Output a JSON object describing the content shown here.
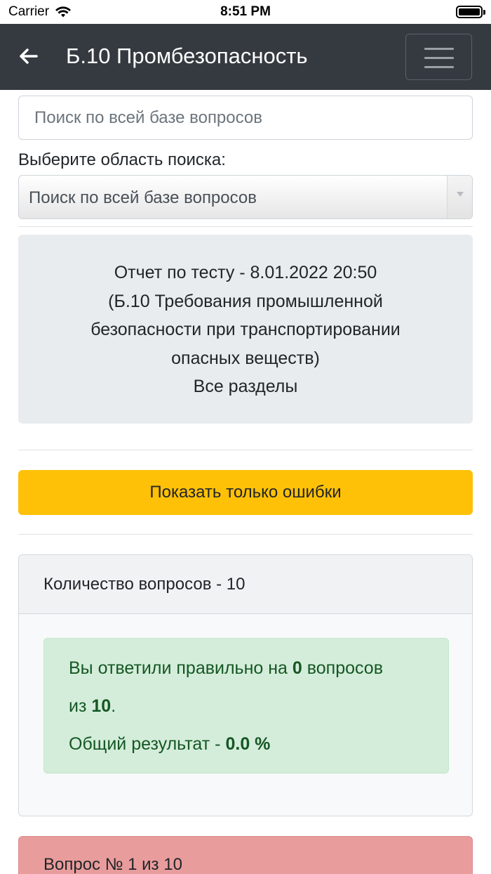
{
  "status_bar": {
    "carrier": "Carrier",
    "time": "8:51 PM"
  },
  "navbar": {
    "title": "Б.10 Промбезопасность"
  },
  "search": {
    "placeholder": "Поиск по всей базе вопросов"
  },
  "scope": {
    "label": "Выберите область поиска:",
    "selected": "Поиск по всей базе вопросов"
  },
  "report": {
    "lines": [
      "Отчет по тесту - 8.01.2022 20:50",
      "(Б.10 Требования промышленной",
      "безопасности при транспортировании",
      "опасных веществ)",
      "Все разделы"
    ]
  },
  "errors_button": {
    "label": "Показать только ошибки"
  },
  "summary": {
    "header": "Количество вопросов - 10",
    "answered_prefix": "Вы ответили правильно на",
    "correct_count": "0",
    "answered_mid": "вопросов",
    "of_word": "из",
    "total_count": "10",
    "total_suffix": ".",
    "result_prefix": "Общий результат -",
    "result_value": "0.0 %"
  },
  "question": {
    "title": "Вопрос № 1 из 10"
  },
  "colors": {
    "navbar": "#343a40",
    "warning": "#ffc107",
    "success_bg": "#d4edda",
    "success_text": "#155724",
    "danger_bg": "#e99c9c"
  }
}
